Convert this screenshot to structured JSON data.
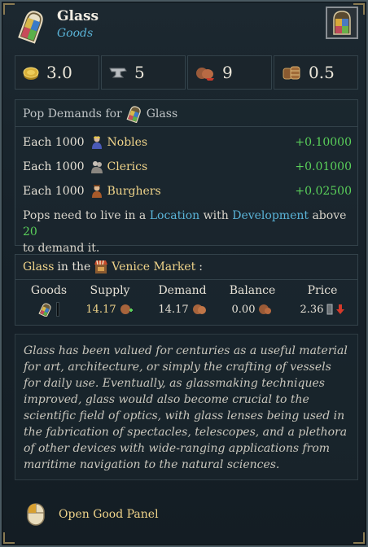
{
  "header": {
    "title": "Glass",
    "subtitle": "Goods"
  },
  "stats": [
    {
      "icon": "gold-coins-icon",
      "value": "3.0"
    },
    {
      "icon": "anvil-icon",
      "value": "5"
    },
    {
      "icon": "goods-sack-icon",
      "value": "9"
    },
    {
      "icon": "barrels-icon",
      "value": "0.5"
    }
  ],
  "demands": {
    "title": "Pop Demands for",
    "title_good": "Glass",
    "rows": [
      {
        "each": "Each 1000",
        "class": "Nobles",
        "icon": "nobles-icon",
        "amount": "+0.10000"
      },
      {
        "each": "Each 1000",
        "class": "Clerics",
        "icon": "clerics-icon",
        "amount": "+0.01000"
      },
      {
        "each": "Each 1000",
        "class": "Burghers",
        "icon": "burghers-icon",
        "amount": "+0.02500"
      }
    ],
    "note": {
      "p1": "Pops need to live in a ",
      "location": "Location",
      "p2": " with ",
      "development": "Development",
      "p3": " above ",
      "threshold": "20",
      "p4": "to demand it."
    }
  },
  "market": {
    "good": "Glass",
    "in_the": "in the",
    "market_name": "Venice Market",
    "colon": ":",
    "columns": {
      "goods": "Goods",
      "supply": "Supply",
      "demand": "Demand",
      "balance": "Balance",
      "price": "Price"
    },
    "values": {
      "supply": "14.17",
      "demand": "14.17",
      "balance": "0.00",
      "price": "2.36"
    }
  },
  "description": "Glass has been valued for centuries as a useful material for art, architecture, or simply the crafting of vessels for daily use. Eventually, as glassmaking techniques improved, glass would also become crucial to the scientific field of optics, with glass lenses being used in the fabrication of spectacles, telescopes, and a plethora of other devices with wide-ranging applications from maritime navigation to the natural sciences.",
  "footer": {
    "action": "Open Good Panel",
    "icon": "mouse-left-click-icon"
  },
  "colors": {
    "accent_gold": "#f0d48a",
    "accent_blue": "#5ab4d8",
    "positive_green": "#5ad05a",
    "negative_red": "#d43a2a"
  }
}
